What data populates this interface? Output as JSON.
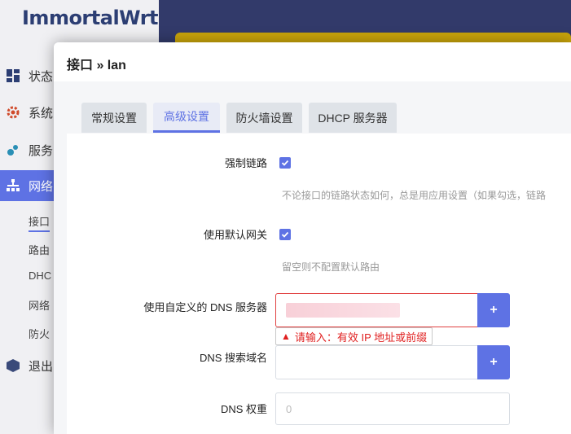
{
  "sidebar": {
    "logo": "ImmortalWrt",
    "items": [
      {
        "label": "状态",
        "icon": "dashboard-icon"
      },
      {
        "label": "系统",
        "icon": "gear-icon"
      },
      {
        "label": "服务",
        "icon": "puzzle-icon"
      },
      {
        "label": "网络",
        "icon": "network-icon"
      },
      {
        "label": "退出",
        "icon": "logout-icon"
      }
    ],
    "subitems": [
      "接口",
      "路由",
      "DHC",
      "网络",
      "防火"
    ]
  },
  "modal": {
    "title": "接口 » lan",
    "tabs": [
      "常规设置",
      "高级设置",
      "防火墙设置",
      "DHCP 服务器"
    ],
    "active_tab": "高级设置"
  },
  "form": {
    "force_link": {
      "label": "强制链路",
      "checked": true,
      "hint": "不论接口的链路状态如何，总是用应用设置（如果勾选，链路"
    },
    "default_gateway": {
      "label": "使用默认网关",
      "checked": true,
      "hint": "留空则不配置默认路由"
    },
    "custom_dns": {
      "label": "使用自定义的 DNS 服务器",
      "add_label": "+",
      "error": "请输入：有效 IP 地址或前缀"
    },
    "dns_search": {
      "label": "DNS 搜索域名",
      "add_label": "+"
    },
    "dns_weight": {
      "label": "DNS 权重",
      "placeholder": "0"
    }
  },
  "colors": {
    "accent": "#5e72e4",
    "error": "#e02020"
  }
}
